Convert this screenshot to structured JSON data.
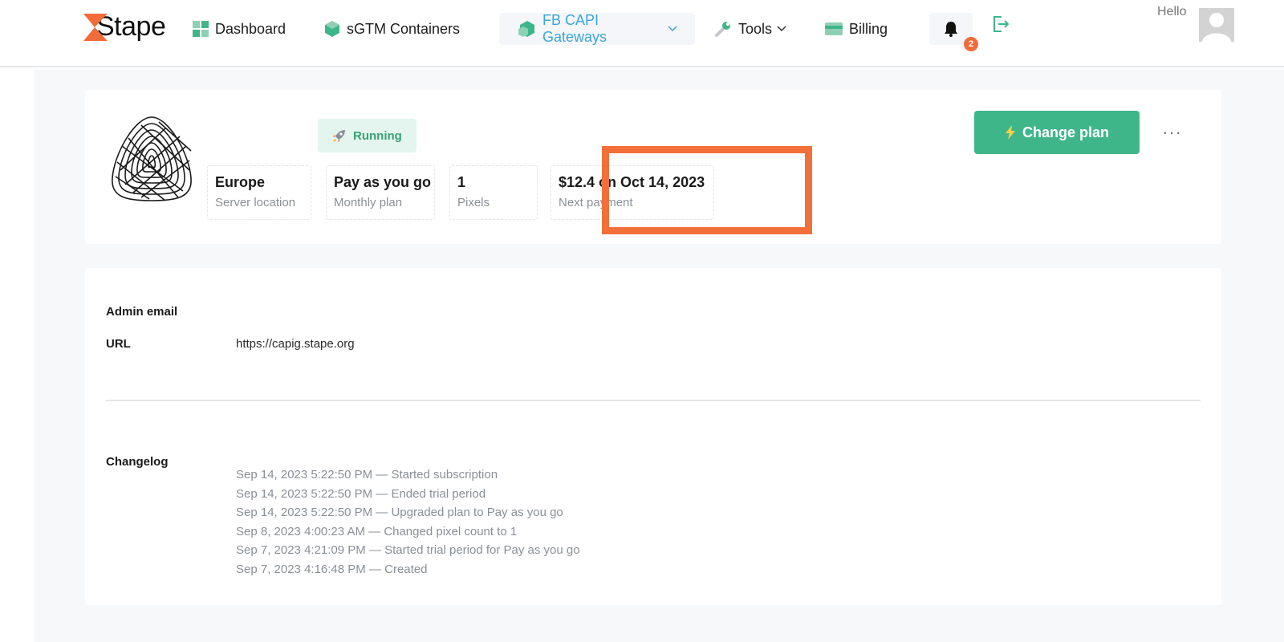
{
  "header": {
    "logo_text": "Stape",
    "nav": [
      {
        "label": "Dashboard"
      },
      {
        "label": "sGTM Containers"
      },
      {
        "label": "FB CAPI Gateways"
      },
      {
        "label": "Tools"
      },
      {
        "label": "Billing"
      }
    ],
    "notifications_count": "2",
    "greeting": "Hello"
  },
  "gateway": {
    "status": "Running",
    "stats": [
      {
        "value": "Europe",
        "label": "Server location"
      },
      {
        "value": "Pay as you go",
        "label": "Monthly plan"
      },
      {
        "value": "1",
        "label": "Pixels"
      },
      {
        "value": "$12.4 on Oct 14, 2023",
        "label": "Next payment"
      }
    ],
    "change_plan_label": "Change plan",
    "more_label": "···"
  },
  "details": {
    "admin_email_label": "Admin email",
    "url_label": "URL",
    "url_value": "https://capig.stape.org",
    "changelog_label": "Changelog",
    "changelog": [
      "Sep 14, 2023 5:22:50 PM — Started subscription",
      "Sep 14, 2023 5:22:50 PM — Ended trial period",
      "Sep 14, 2023 5:22:50 PM — Upgraded plan to Pay as you go",
      "Sep 8, 2023 4:00:23 AM — Changed pixel count to 1",
      "Sep 7, 2023 4:21:09 PM — Started trial period for Pay as you go",
      "Sep 7, 2023 4:16:48 PM — Created"
    ]
  },
  "colors": {
    "accent_green": "#3fb68a",
    "accent_blue": "#3aa6d9",
    "highlight_orange": "#f26f3a"
  }
}
